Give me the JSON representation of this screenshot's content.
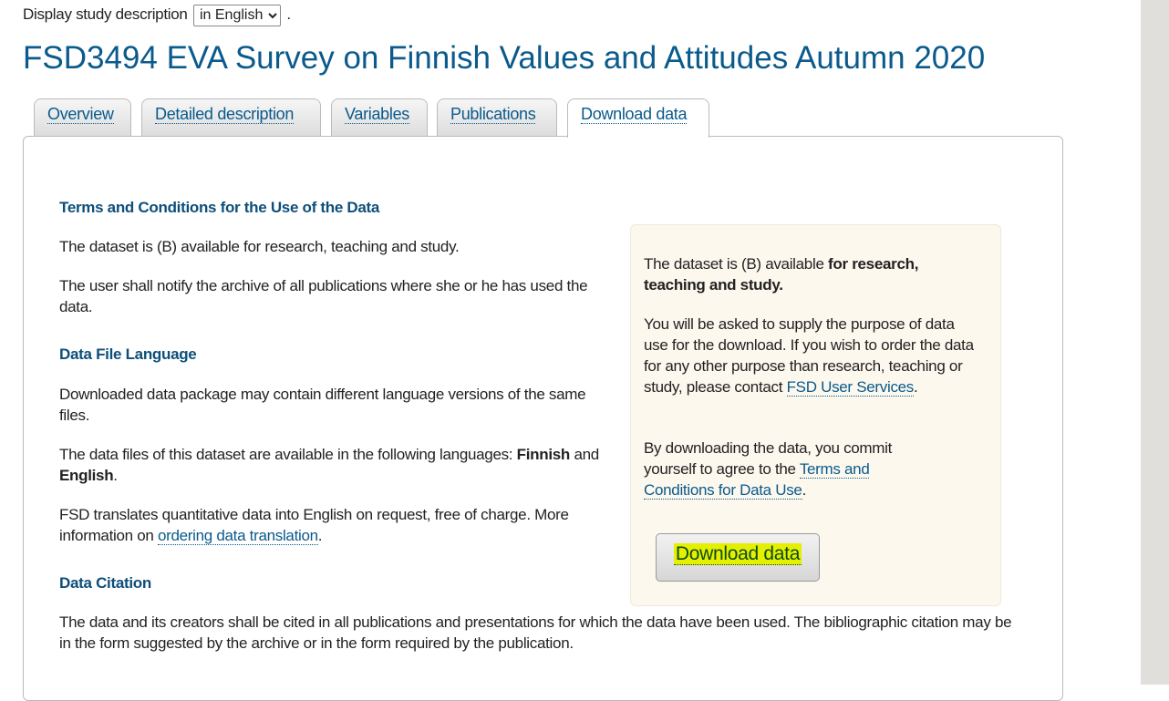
{
  "language_selector": {
    "prefix": "Display study description",
    "selected": "in English",
    "suffix": "."
  },
  "title": "FSD3494 EVA Survey on Finnish Values and Attitudes Autumn 2020",
  "tabs": [
    {
      "label": "Overview"
    },
    {
      "label": "Detailed description"
    },
    {
      "label": "Variables"
    },
    {
      "label": "Publications"
    },
    {
      "label": "Download data",
      "active": true
    }
  ],
  "main": {
    "terms_heading": "Terms and Conditions for the Use of the Data",
    "terms_p1": "The dataset is (B) available for research, teaching and study.",
    "terms_p2": "The user shall notify the archive of all publications where she or he has used the data.",
    "lang_heading": "Data File Language",
    "lang_p1": "Downloaded data package may contain different language versions of the same files.",
    "lang_p2_a": "The data files of this dataset are available in the following languages:",
    "lang_finnish": "Finnish",
    "lang_and": " and ",
    "lang_english": "English",
    "lang_p2_end": ".",
    "lang_p3_a": "FSD translates quantitative data into English on request, free of charge. More information on ",
    "lang_p3_link": "ordering data translation",
    "lang_p3_end": ".",
    "citation_heading": "Data Citation",
    "citation_p": "The data and its creators shall be cited in all publications and presentations for which the data have been used. The bibliographic citation may be in the form suggested by the archive or in the form required by the publication."
  },
  "sidebox": {
    "p1_a": "The dataset is (B) available ",
    "p1_bold": "for research, teaching and study.",
    "p2_a": "You will be asked to supply the purpose of data use for the download. If you wish to order the data for any other purpose than research, teaching or study, please contact ",
    "p2_link": "FSD User Services",
    "p2_end": ".",
    "p3_a": "By downloading the data, you commit yourself to agree to the ",
    "p3_link": "Terms and Conditions for Data Use",
    "p3_end": ".",
    "download_button": "Download data",
    "highlight_color": "#e5f000"
  }
}
